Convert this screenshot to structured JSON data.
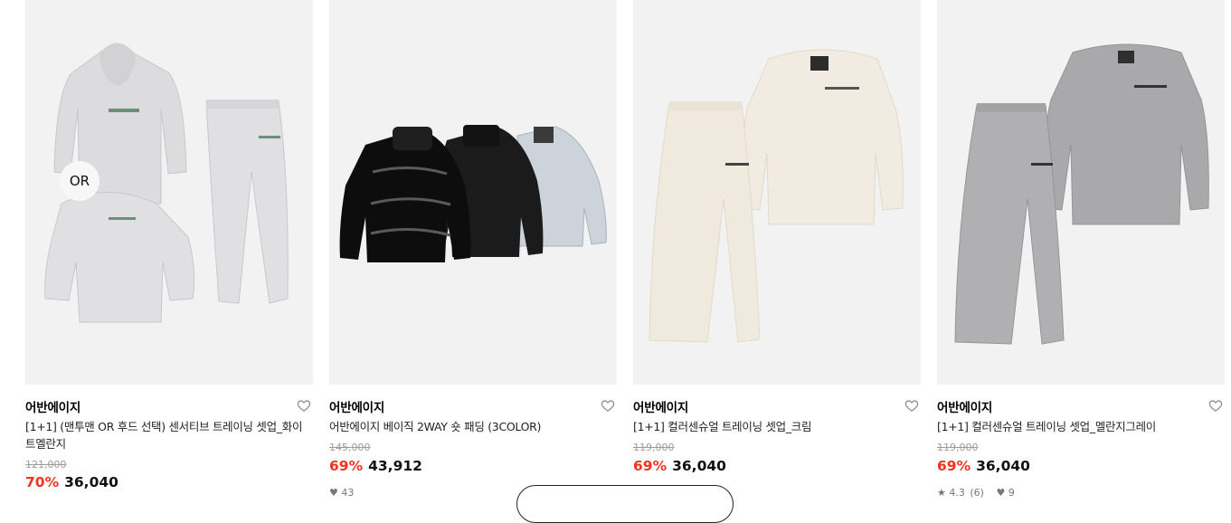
{
  "products": [
    {
      "brand": "어반에이지",
      "title": "[1+1] (맨투맨 OR 후드 선택) 센서티브 트레이닝 셋업_화이트멜란지",
      "original_price": "121,000",
      "discount": "70%",
      "price": "36,040",
      "image_badge": "OR",
      "rating": "",
      "reviews": "",
      "likes": ""
    },
    {
      "brand": "어반에이지",
      "title": "어반에이지 베이직 2WAY 숏 패딩 (3COLOR)",
      "original_price": "145,000",
      "discount": "69%",
      "price": "43,912",
      "rating": "",
      "reviews": "",
      "likes": "43"
    },
    {
      "brand": "어반에이지",
      "title": "[1+1] 컬러센슈얼 트레이닝 셋업_크림",
      "original_price": "119,000",
      "discount": "69%",
      "price": "36,040",
      "rating": "",
      "reviews": "",
      "likes": ""
    },
    {
      "brand": "어반에이지",
      "title": "[1+1] 컬러센슈얼 트레이닝 셋업_멜란지그레이",
      "original_price": "119,000",
      "discount": "69%",
      "price": "36,040",
      "rating": "4.3",
      "reviews": "(6)",
      "likes": "9"
    }
  ],
  "colors": {
    "image_bg": "#f2f2f2",
    "discount": "#f0341f",
    "muted": "#9b9b9b"
  }
}
